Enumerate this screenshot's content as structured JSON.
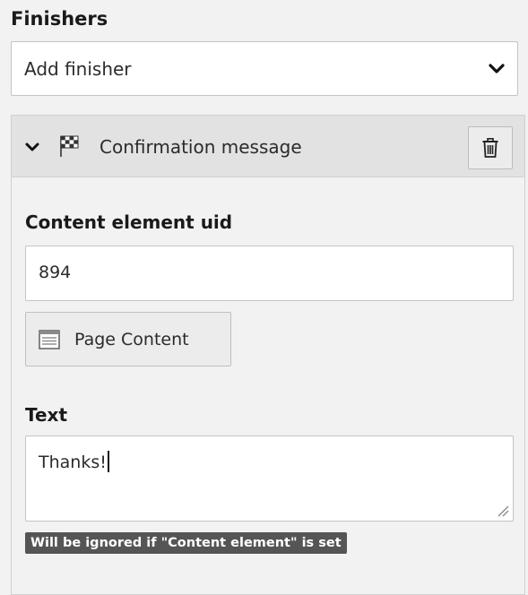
{
  "finishers": {
    "title": "Finishers",
    "add_select": {
      "value": "Add finisher",
      "icon": "chevron-down-icon"
    }
  },
  "finisher_panel": {
    "title": "Confirmation message",
    "toggle_icon": "chevron-down-icon",
    "type_icon": "checkered-flag-icon",
    "delete_icon": "trash-icon",
    "content_element_uid": {
      "label": "Content element uid",
      "value": "894",
      "browse_button": {
        "label": "Page Content",
        "icon": "page-content-icon"
      }
    },
    "text": {
      "label": "Text",
      "value": "Thanks!",
      "hint": "Will be ignored if \"Content element\" is set"
    }
  },
  "colors": {
    "background": "#f2f2f2",
    "panel_header": "#e2e2e2",
    "hint_badge": "#555555"
  }
}
